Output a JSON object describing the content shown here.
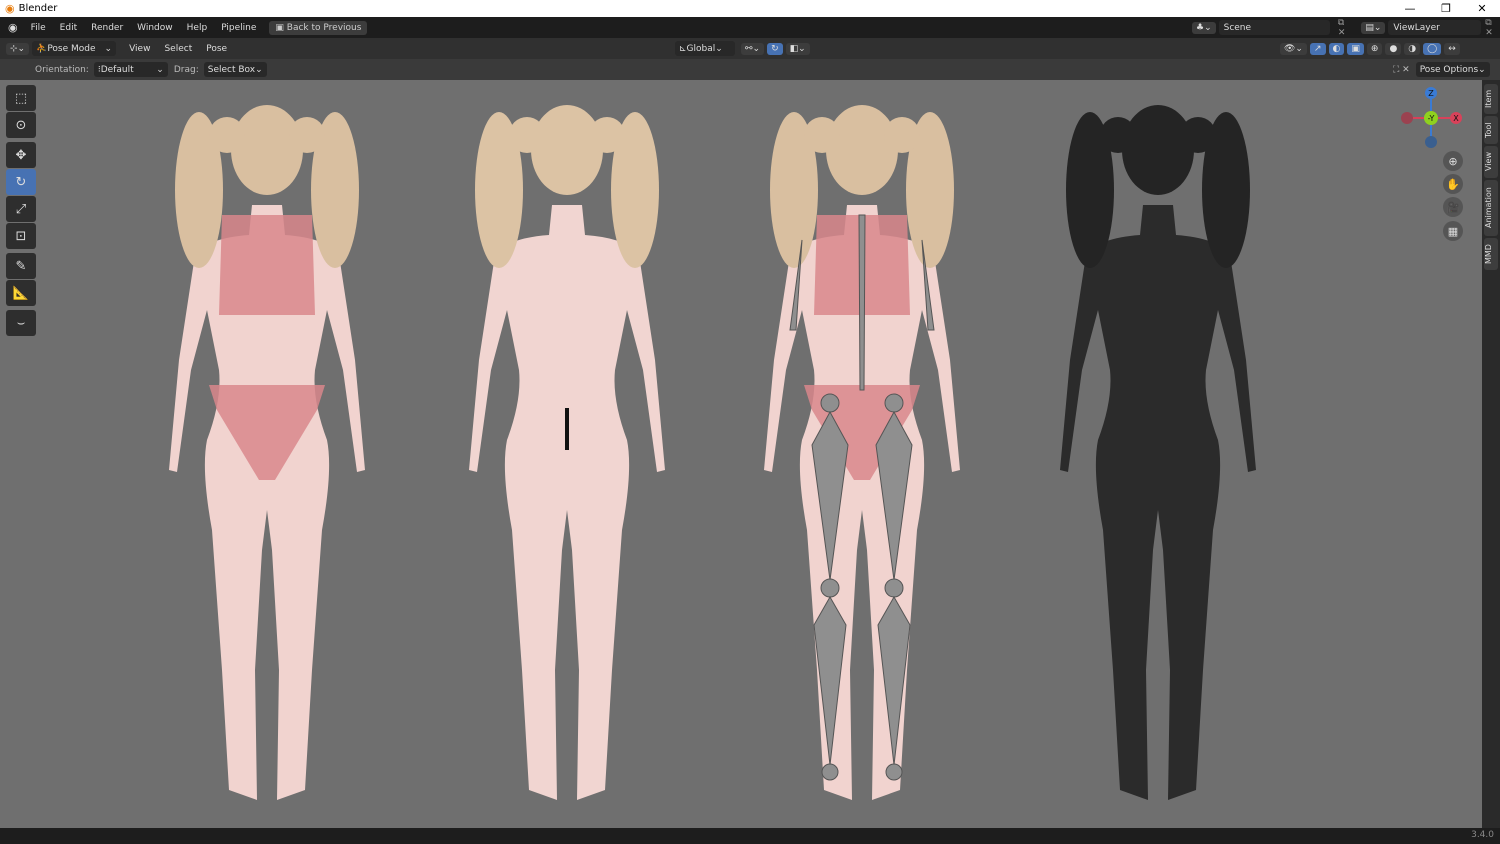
{
  "window": {
    "title": "Blender",
    "controls": [
      "—",
      "❐",
      "✕"
    ]
  },
  "menu": [
    "File",
    "Edit",
    "Render",
    "Window",
    "Help",
    "Pipeline"
  ],
  "back_button": "Back to Previous",
  "scene": "Scene",
  "view_layer": "ViewLayer",
  "header": {
    "mode": "Pose Mode",
    "menus": [
      "View",
      "Select",
      "Pose"
    ],
    "transform_orientation": "Global"
  },
  "tool_settings": {
    "orientation_label": "Orientation:",
    "orientation": "Default",
    "drag_label": "Drag:",
    "drag": "Select Box",
    "pose_options": "Pose Options"
  },
  "gizmo": {
    "z": "Z",
    "y": "-Y",
    "x": "X"
  },
  "sidebar_tabs": [
    "Item",
    "Tool",
    "View",
    "Animation",
    "MMD"
  ],
  "version": "3.4.0",
  "colors": {
    "accent": "#4772b3",
    "viewport": "#6f6f6f",
    "skin": "#f1d3cf",
    "garment": "#d9878c",
    "bone": "#8f8f8f",
    "wire": "#2b2b2b"
  }
}
